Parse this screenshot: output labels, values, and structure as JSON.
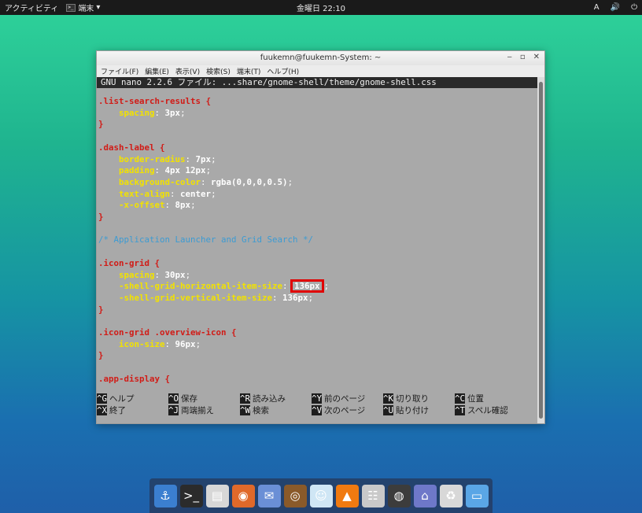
{
  "topbar": {
    "activities": "アクティビティ",
    "app_menu": "端末",
    "app_menu_arrow": "▾",
    "clock": "金曜日 22:10",
    "keyboard": "A",
    "tray_volume": "🔊",
    "tray_power": "⏻"
  },
  "window": {
    "title": "fuukemn@fuukemn-System: ~",
    "minimize": "‒",
    "maximize": "▫",
    "close": "✕",
    "menu": [
      "ファイル(F)",
      "編集(E)",
      "表示(V)",
      "検索(S)",
      "端末(T)",
      "ヘルプ(H)"
    ]
  },
  "nano": {
    "header": "GNU nano 2.2.6 ファイル: ...share/gnome-shell/theme/gnome-shell.css",
    "lines": [
      {
        "row": 0,
        "parts": [
          {
            "t": ".list-search-results {",
            "c": "sel"
          }
        ]
      },
      {
        "row": 1,
        "parts": [
          {
            "t": "    "
          },
          {
            "t": "spacing",
            "c": "prop"
          },
          {
            "t": ": ",
            "c": "punct"
          },
          {
            "t": "3px",
            "c": "val"
          },
          {
            "t": ";",
            "c": "punct"
          }
        ]
      },
      {
        "row": 2,
        "parts": [
          {
            "t": "}",
            "c": "sel"
          }
        ]
      },
      {
        "row": 4,
        "parts": [
          {
            "t": ".dash-label {",
            "c": "sel"
          }
        ]
      },
      {
        "row": 5,
        "parts": [
          {
            "t": "    "
          },
          {
            "t": "border-radius",
            "c": "prop"
          },
          {
            "t": ": ",
            "c": "punct"
          },
          {
            "t": "7px",
            "c": "val"
          },
          {
            "t": ";",
            "c": "punct"
          }
        ]
      },
      {
        "row": 6,
        "parts": [
          {
            "t": "    "
          },
          {
            "t": "padding",
            "c": "prop"
          },
          {
            "t": ": ",
            "c": "punct"
          },
          {
            "t": "4px 12px",
            "c": "val"
          },
          {
            "t": ";",
            "c": "punct"
          }
        ]
      },
      {
        "row": 7,
        "parts": [
          {
            "t": "    "
          },
          {
            "t": "background-color",
            "c": "prop"
          },
          {
            "t": ": ",
            "c": "punct"
          },
          {
            "t": "rgba(0,0,0,0.5)",
            "c": "val"
          },
          {
            "t": ";",
            "c": "punct"
          }
        ]
      },
      {
        "row": 8,
        "parts": [
          {
            "t": "    "
          },
          {
            "t": "text-align",
            "c": "prop"
          },
          {
            "t": ": ",
            "c": "punct"
          },
          {
            "t": "center",
            "c": "val"
          },
          {
            "t": ";",
            "c": "punct"
          }
        ]
      },
      {
        "row": 9,
        "parts": [
          {
            "t": "    "
          },
          {
            "t": "-x-offset",
            "c": "prop"
          },
          {
            "t": ": ",
            "c": "punct"
          },
          {
            "t": "8px",
            "c": "val"
          },
          {
            "t": ";",
            "c": "punct"
          }
        ]
      },
      {
        "row": 10,
        "parts": [
          {
            "t": "}",
            "c": "sel"
          }
        ]
      },
      {
        "row": 12,
        "parts": [
          {
            "t": "/* Application Launcher and Grid Search */",
            "c": "comment"
          }
        ]
      },
      {
        "row": 14,
        "parts": [
          {
            "t": ".icon-grid {",
            "c": "sel"
          }
        ]
      },
      {
        "row": 15,
        "parts": [
          {
            "t": "    "
          },
          {
            "t": "spacing",
            "c": "prop"
          },
          {
            "t": ": ",
            "c": "punct"
          },
          {
            "t": "30px",
            "c": "val"
          },
          {
            "t": ";",
            "c": "punct"
          }
        ]
      },
      {
        "row": 16,
        "parts": [
          {
            "t": "    "
          },
          {
            "t": "-shell-grid-horizontal-item-size",
            "c": "prop"
          },
          {
            "t": ": ",
            "c": "punct"
          },
          {
            "t": "136px",
            "c": "val",
            "box": true
          },
          {
            "t": ";",
            "c": "punct"
          }
        ]
      },
      {
        "row": 17,
        "parts": [
          {
            "t": "    "
          },
          {
            "t": "-shell-grid-vertical-item-size",
            "c": "prop"
          },
          {
            "t": ": ",
            "c": "punct"
          },
          {
            "t": "136px",
            "c": "val"
          },
          {
            "t": ";",
            "c": "punct"
          }
        ]
      },
      {
        "row": 18,
        "parts": [
          {
            "t": "}",
            "c": "sel"
          }
        ]
      },
      {
        "row": 20,
        "parts": [
          {
            "t": ".icon-grid .overview-icon {",
            "c": "sel"
          }
        ]
      },
      {
        "row": 21,
        "parts": [
          {
            "t": "    "
          },
          {
            "t": "icon-size",
            "c": "prop"
          },
          {
            "t": ": ",
            "c": "punct"
          },
          {
            "t": "96px",
            "c": "val"
          },
          {
            "t": ";",
            "c": "punct"
          }
        ]
      },
      {
        "row": 22,
        "parts": [
          {
            "t": "}",
            "c": "sel"
          }
        ]
      },
      {
        "row": 24,
        "parts": [
          {
            "t": ".app-display {",
            "c": "sel"
          }
        ]
      }
    ],
    "shortcuts": [
      {
        "row": 0,
        "col": 0,
        "key": "^G",
        "label": "ヘルプ"
      },
      {
        "row": 0,
        "col": 1,
        "key": "^O",
        "label": "保存"
      },
      {
        "row": 0,
        "col": 2,
        "key": "^R",
        "label": "読み込み"
      },
      {
        "row": 0,
        "col": 3,
        "key": "^Y",
        "label": "前のページ"
      },
      {
        "row": 0,
        "col": 4,
        "key": "^K",
        "label": "切り取り"
      },
      {
        "row": 0,
        "col": 5,
        "key": "^C",
        "label": "位置"
      },
      {
        "row": 1,
        "col": 0,
        "key": "^X",
        "label": "終了"
      },
      {
        "row": 1,
        "col": 1,
        "key": "^J",
        "label": "両端揃え"
      },
      {
        "row": 1,
        "col": 2,
        "key": "^W",
        "label": "検索"
      },
      {
        "row": 1,
        "col": 3,
        "key": "^V",
        "label": "次のページ"
      },
      {
        "row": 1,
        "col": 4,
        "key": "^U",
        "label": "貼り付け"
      },
      {
        "row": 1,
        "col": 5,
        "key": "^T",
        "label": "スペル確認"
      }
    ]
  },
  "dock": {
    "items": [
      {
        "name": "anchor-icon",
        "glyph": "⚓",
        "color": "#3b7fd0"
      },
      {
        "name": "terminal-icon",
        "glyph": ">_",
        "color": "#2b2b2b"
      },
      {
        "name": "files-icon",
        "glyph": "▤",
        "color": "#d7d7d7"
      },
      {
        "name": "firefox-icon",
        "glyph": "◉",
        "color": "#e0692a"
      },
      {
        "name": "stamp-icon",
        "glyph": "✉",
        "color": "#6a8fd6"
      },
      {
        "name": "speaker-icon",
        "glyph": "◎",
        "color": "#8a5a2a"
      },
      {
        "name": "chat-icon",
        "glyph": "☺",
        "color": "#cfe6f5"
      },
      {
        "name": "vlc-icon",
        "glyph": "▲",
        "color": "#f07a10"
      },
      {
        "name": "mixer-icon",
        "glyph": "☷",
        "color": "#c9c9c9"
      },
      {
        "name": "disc-icon",
        "glyph": "◍",
        "color": "#3c3c3c"
      },
      {
        "name": "home-icon",
        "glyph": "⌂",
        "color": "#6e78c9"
      },
      {
        "name": "trash-icon",
        "glyph": "♻",
        "color": "#d8d8d8"
      },
      {
        "name": "window-icon",
        "glyph": "▭",
        "color": "#5aa6e6"
      }
    ]
  }
}
